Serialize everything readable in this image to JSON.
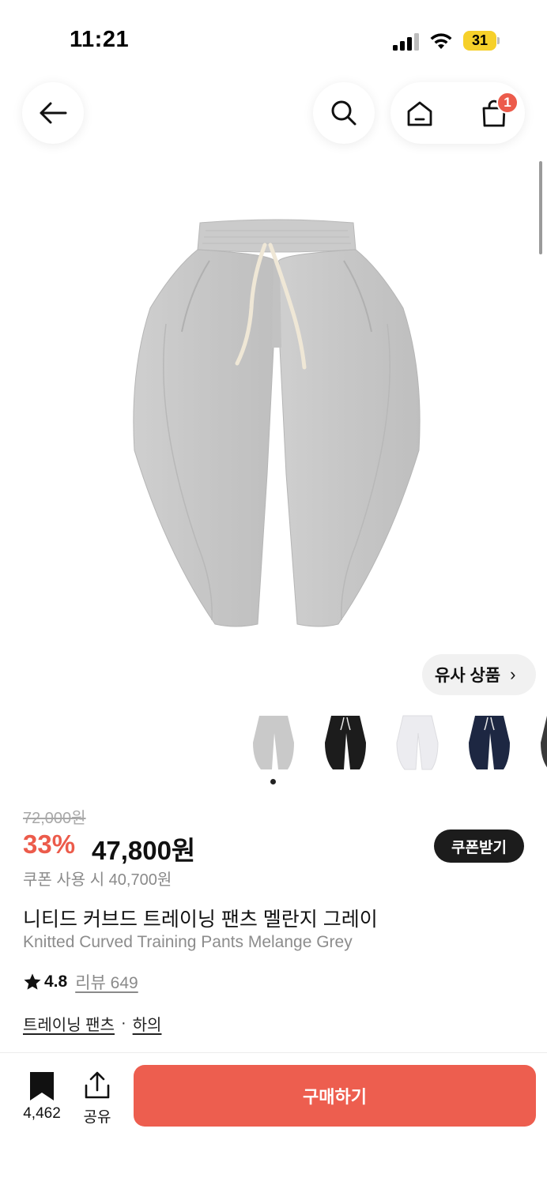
{
  "status_bar": {
    "time": "11:21",
    "battery_level": "31"
  },
  "nav": {
    "cart_badge": "1"
  },
  "similar_button": {
    "label": "유사 상품",
    "chevron": "›"
  },
  "thumbnails": [
    {
      "color_name": "grey",
      "color": "#c9c9c9"
    },
    {
      "color_name": "black",
      "color": "#1c1c1c"
    },
    {
      "color_name": "white",
      "color": "#ececf0"
    },
    {
      "color_name": "navy",
      "color": "#1d2742"
    },
    {
      "color_name": "charcoal",
      "color": "#3a3a3a"
    }
  ],
  "product": {
    "original_price": "72,000원",
    "discount_rate": "33%",
    "sale_price": "47,800원",
    "coupon_button": "쿠폰받기",
    "coupon_price": "쿠폰 사용 시 40,700원",
    "title_ko": "니티드 커브드 트레이닝 팬츠 멜란지 그레이",
    "title_en": "Knitted Curved Training Pants Melange Grey",
    "rating": "4.8",
    "review_label": "리뷰 649",
    "categories": [
      "트레이닝 팬츠",
      "하의"
    ],
    "category_separator": "·"
  },
  "bottom_bar": {
    "bookmark_count": "4,462",
    "share_label": "공유",
    "buy_label": "구매하기"
  },
  "colors": {
    "accent": "#ec5b4b",
    "dark_button": "#1c1c1c",
    "battery": "#f6d02a"
  }
}
